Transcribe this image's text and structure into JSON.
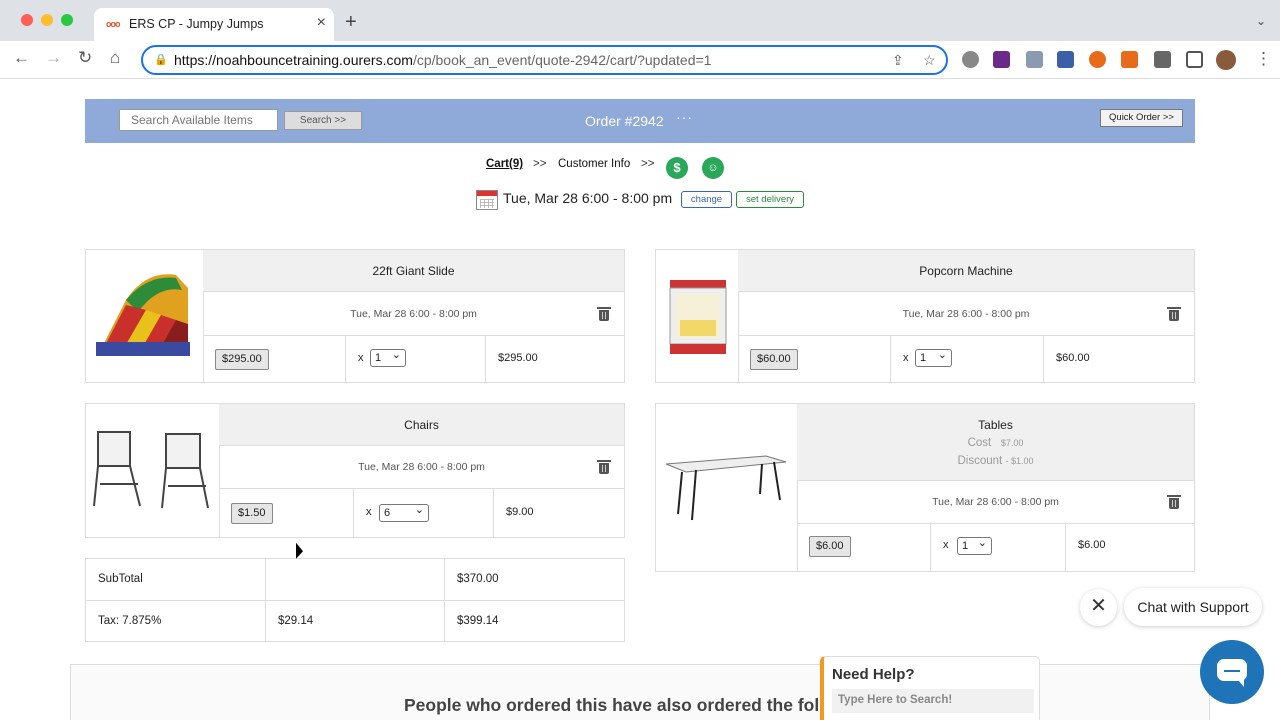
{
  "browser": {
    "tab_title": "ERS CP - Jumpy Jumps",
    "tab_favicon": "ers",
    "url_host": "https://noahbouncetraining.ourers.com",
    "url_path": "/cp/book_an_event/quote-2942/cart/?updated=1"
  },
  "header": {
    "search_placeholder": "Search Available Items",
    "search_button": "Search >>",
    "order_title": "Order #2942",
    "menu_dots": "···",
    "quick_order": "Quick Order >>"
  },
  "steps": {
    "cart": "Cart(9)",
    "sep": ">>",
    "customer_info": "Customer Info",
    "payment_icon": "$"
  },
  "event": {
    "date": "Tue, Mar 28 6:00 - 8:00 pm",
    "change": "change",
    "set_delivery": "set delivery"
  },
  "items": [
    {
      "name": "22ft Giant Slide",
      "date": "Tue, Mar 28 6:00 - 8:00 pm",
      "price": "$295.00",
      "qty": "1",
      "total": "$295.00",
      "x": "x"
    },
    {
      "name": "Popcorn Machine",
      "date": "Tue, Mar 28 6:00 - 8:00 pm",
      "price": "$60.00",
      "qty": "1",
      "total": "$60.00",
      "x": "x"
    },
    {
      "name": "Chairs",
      "date": "Tue, Mar 28 6:00 - 8:00 pm",
      "price": "$1.50",
      "qty": "6",
      "total": "$9.00",
      "x": "x"
    },
    {
      "name": "Tables",
      "cost_label": "Cost",
      "cost_value": "$7.00",
      "discount_label": "Discount",
      "discount_value": "- $1.00",
      "date": "Tue, Mar 28 6:00 - 8:00 pm",
      "price": "$6.00",
      "qty": "1",
      "total": "$6.00",
      "x": "x"
    }
  ],
  "totals": {
    "subtotal_label": "SubTotal",
    "subtotal_value": "$370.00",
    "tax_label": "Tax: 7.875%",
    "tax_value": "$29.14",
    "grand_total": "$399.14"
  },
  "recommend": {
    "heading": "People who ordered this have also ordered the foll"
  },
  "chat": {
    "label": "Chat with Support",
    "close": "✕"
  },
  "help": {
    "title": "Need Help?",
    "placeholder": "Type Here to Search!"
  }
}
